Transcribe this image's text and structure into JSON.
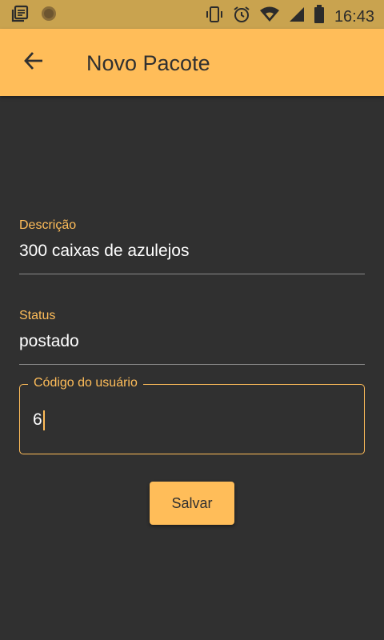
{
  "status_bar": {
    "time": "16:43",
    "icons": [
      "notes-icon",
      "app-circle-icon",
      "vibrate-icon",
      "alarm-icon",
      "wifi-icon",
      "signal-icon",
      "battery-icon"
    ]
  },
  "app_bar": {
    "back_icon": "arrow-back-icon",
    "title": "Novo Pacote"
  },
  "form": {
    "descricao": {
      "label": "Descrição",
      "value": "300 caixas de azulejos"
    },
    "status": {
      "label": "Status",
      "value": "postado"
    },
    "codigo_usuario": {
      "label": "Código do usuário",
      "value": "6"
    },
    "save_label": "Salvar"
  },
  "colors": {
    "accent": "#ffbd59",
    "status_bar": "#c9a34f",
    "background": "#303030",
    "text": "#ffffff"
  }
}
